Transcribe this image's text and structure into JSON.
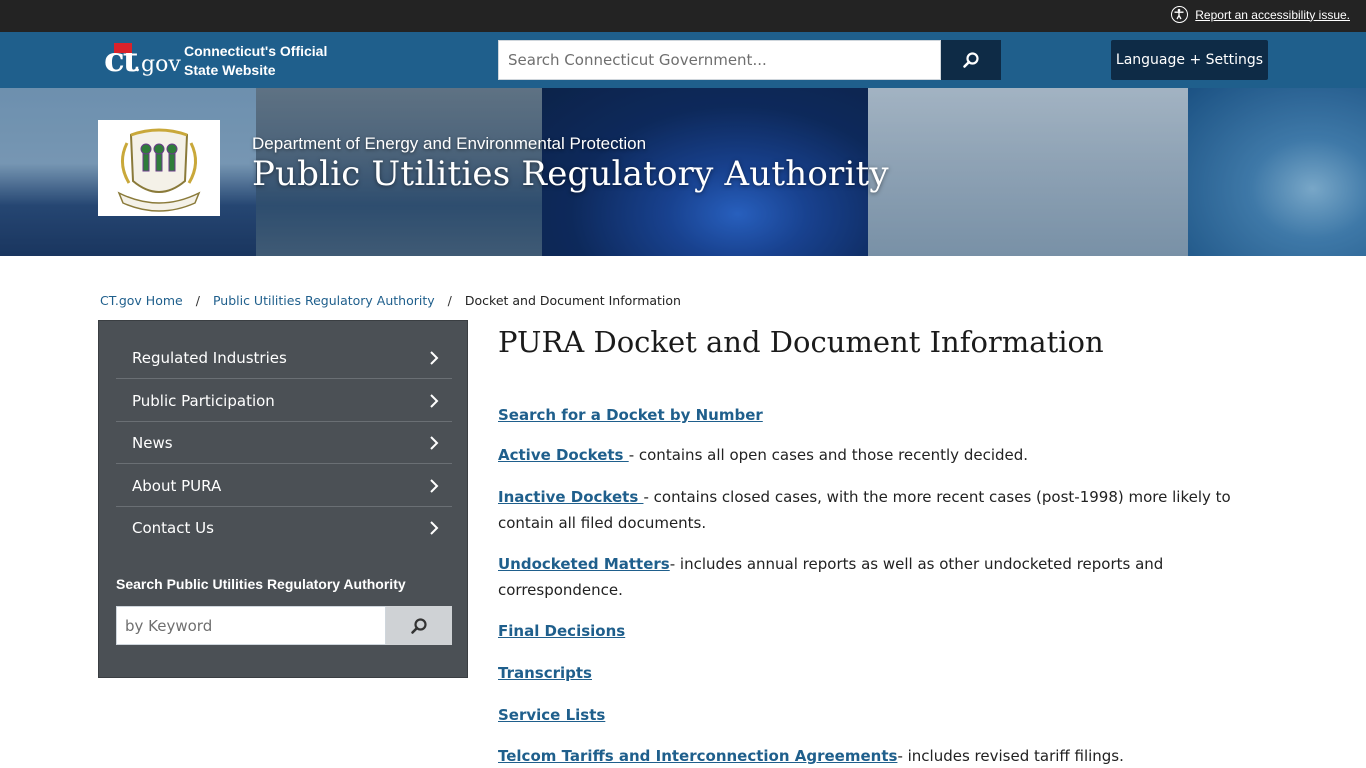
{
  "utility_bar": {
    "accessibility_link": "Report an accessibility issue."
  },
  "header": {
    "logo_ct": "ct",
    "logo_gov": ".gov",
    "site_name_line1": "Connecticut's Official",
    "site_name_line2": "State Website",
    "search_placeholder": "Search Connecticut Government...",
    "language_button": "Language + Settings"
  },
  "banner": {
    "department": "Department of Energy and Environmental Protection",
    "agency": "Public Utilities Regulatory Authority"
  },
  "breadcrumb": {
    "items": [
      "CT.gov Home",
      "Public Utilities Regulatory Authority"
    ],
    "current": "Docket and Document Information",
    "separator": "/"
  },
  "sidebar": {
    "items": [
      {
        "label": "Regulated Industries"
      },
      {
        "label": "Public Participation"
      },
      {
        "label": "News"
      },
      {
        "label": "About PURA"
      },
      {
        "label": "Contact Us"
      }
    ],
    "search_label": "Search Public Utilities Regulatory Authority",
    "search_placeholder": "by Keyword"
  },
  "main": {
    "title": "PURA Docket and Document Information",
    "entries": [
      {
        "link": "Search for a Docket by Number",
        "text": ""
      },
      {
        "link": "Active Dockets ",
        "text": "-  contains all open cases and those recently decided."
      },
      {
        "link": "Inactive Dockets ",
        "text": "- contains closed cases, with the more recent cases (post-1998) more likely to contain all filed documents."
      },
      {
        "link": "Undocketed Matters",
        "text": "- includes annual reports as well as other undocketed reports and correspondence."
      },
      {
        "link": "Final Decisions ",
        "text": ""
      },
      {
        "link": "Transcripts",
        "text": ""
      },
      {
        "link": "Service Lists",
        "text": ""
      },
      {
        "link": "Telcom Tariffs and Interconnection Agreements",
        "text": "- includes revised tariff filings."
      }
    ]
  },
  "colors": {
    "topbar": "#232323",
    "header": "#1f5f8c",
    "button_dark": "#0e2b46",
    "sidebar": "#4b5055",
    "link": "#1f5f8c"
  }
}
